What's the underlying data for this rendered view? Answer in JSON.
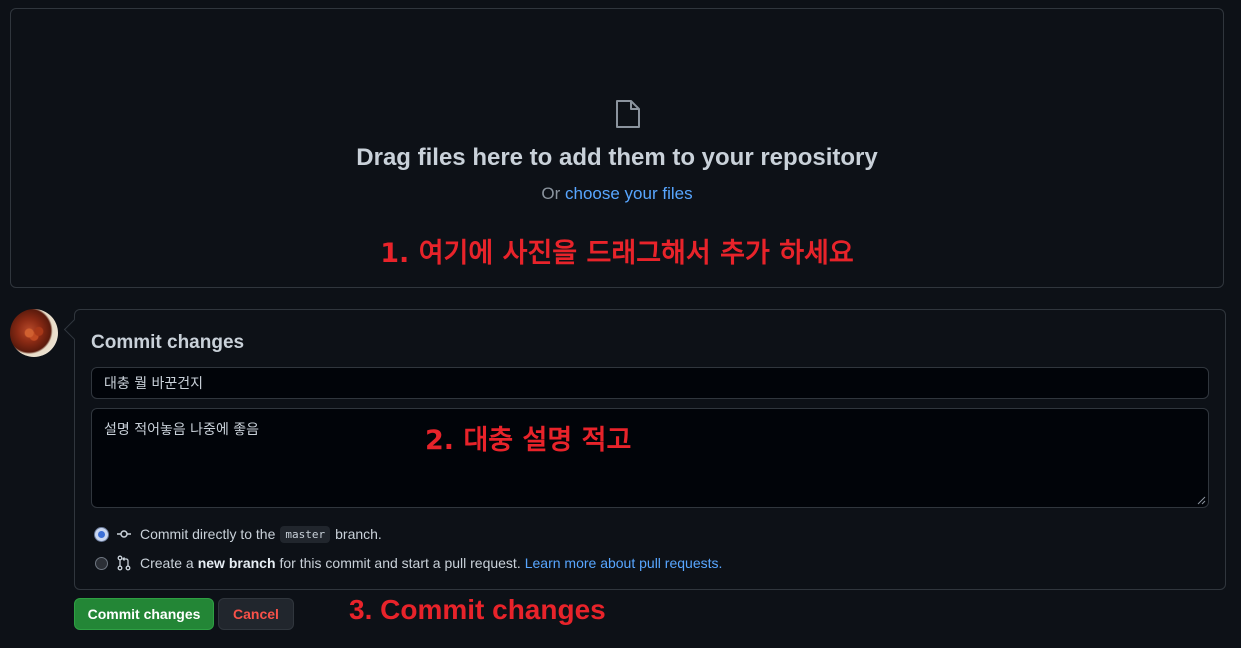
{
  "dropzone": {
    "icon": "file-icon",
    "title": "Drag files here to add them to your repository",
    "or_text": "Or",
    "choose_link": "choose your files"
  },
  "annotations": {
    "step1": "1. 여기에 사진을 드래그해서 추가 하세요",
    "step2": "2. 대충 설명 적고",
    "step3": "3. Commit changes",
    "color": "#e8232a"
  },
  "commit": {
    "title": "Commit changes",
    "summary_value": "대충 뭘 바꾼건지",
    "description_value": "설명 적어놓음 나중에 좋음",
    "option_direct": {
      "prefix": "Commit directly to the",
      "branch": "master",
      "suffix": "branch.",
      "icon": "git-commit-icon",
      "selected": true
    },
    "option_new_branch": {
      "prefix": "Create a",
      "bold": "new branch",
      "suffix": "for this commit and start a pull request.",
      "link": "Learn more about pull requests.",
      "icon": "git-pull-request-icon",
      "selected": false
    }
  },
  "buttons": {
    "commit_label": "Commit changes",
    "cancel_label": "Cancel"
  },
  "colors": {
    "background": "#0d1117",
    "border": "#30363d",
    "link": "#58a6ff",
    "primary_button": "#238636",
    "danger_text": "#f85149"
  }
}
